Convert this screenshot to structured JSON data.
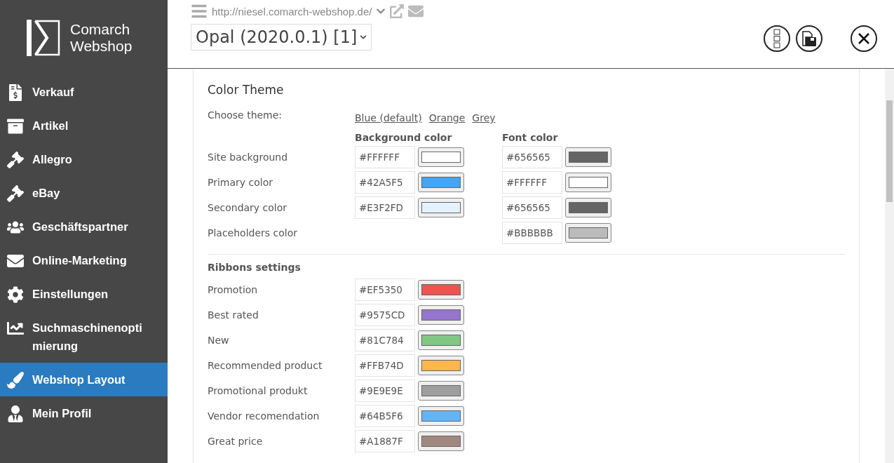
{
  "brand": {
    "line1": "Comarch",
    "line2": "Webshop"
  },
  "sidebar": {
    "items": [
      {
        "label": "Verkauf",
        "selected": false
      },
      {
        "label": "Artikel",
        "selected": false
      },
      {
        "label": "Allegro",
        "selected": false
      },
      {
        "label": "eBay",
        "selected": false
      },
      {
        "label": "Geschäftspartner",
        "selected": false
      },
      {
        "label": "Online-Marketing",
        "selected": false
      },
      {
        "label": "Einstellungen",
        "selected": false
      },
      {
        "label": "Suchmaschinenoptimierung",
        "selected": false
      },
      {
        "label": "Webshop Layout",
        "selected": true
      },
      {
        "label": "Mein Profil",
        "selected": false
      }
    ]
  },
  "header": {
    "url": "http://niesel.comarch-webshop.de/",
    "version": "Opal (2020.0.1) [1]"
  },
  "color_theme": {
    "title": "Color Theme",
    "choose_label": "Choose theme:",
    "themes": [
      "Blue (default)",
      "Orange",
      "Grey"
    ],
    "bg_heading": "Background color",
    "font_heading": "Font color",
    "rows": [
      {
        "label": "Site background",
        "background": {
          "value": "#FFFFFF",
          "color": "#ffffff"
        },
        "font": {
          "value": "#656565",
          "color": "#656565"
        }
      },
      {
        "label": "Primary color",
        "background": {
          "value": "#42A5F5",
          "color": "#42a5f5"
        },
        "font": {
          "value": "#FFFFFF",
          "color": "#ffffff"
        }
      },
      {
        "label": "Secondary color",
        "background": {
          "value": "#E3F2FD",
          "color": "#e3f2fd"
        },
        "font": {
          "value": "#656565",
          "color": "#656565"
        }
      },
      {
        "label": "Placeholders color",
        "font": {
          "value": "#BBBBBB",
          "color": "#bbbbbb"
        }
      }
    ]
  },
  "ribbons": {
    "title": "Ribbons settings",
    "rows": [
      {
        "label": "Promotion",
        "value": "#EF5350",
        "color": "#ef5350"
      },
      {
        "label": "Best rated",
        "value": "#9575CD",
        "color": "#9575cd"
      },
      {
        "label": "New",
        "value": "#81C784",
        "color": "#81c784"
      },
      {
        "label": "Recommended product",
        "value": "#FFB74D",
        "color": "#ffb74d"
      },
      {
        "label": "Promotional produkt",
        "value": "#9E9E9E",
        "color": "#9e9e9e"
      },
      {
        "label": "Vendor recomendation",
        "value": "#64B5F6",
        "color": "#64b5f6"
      },
      {
        "label": "Great price",
        "value": "#A1887F",
        "color": "#a1887f"
      }
    ]
  }
}
